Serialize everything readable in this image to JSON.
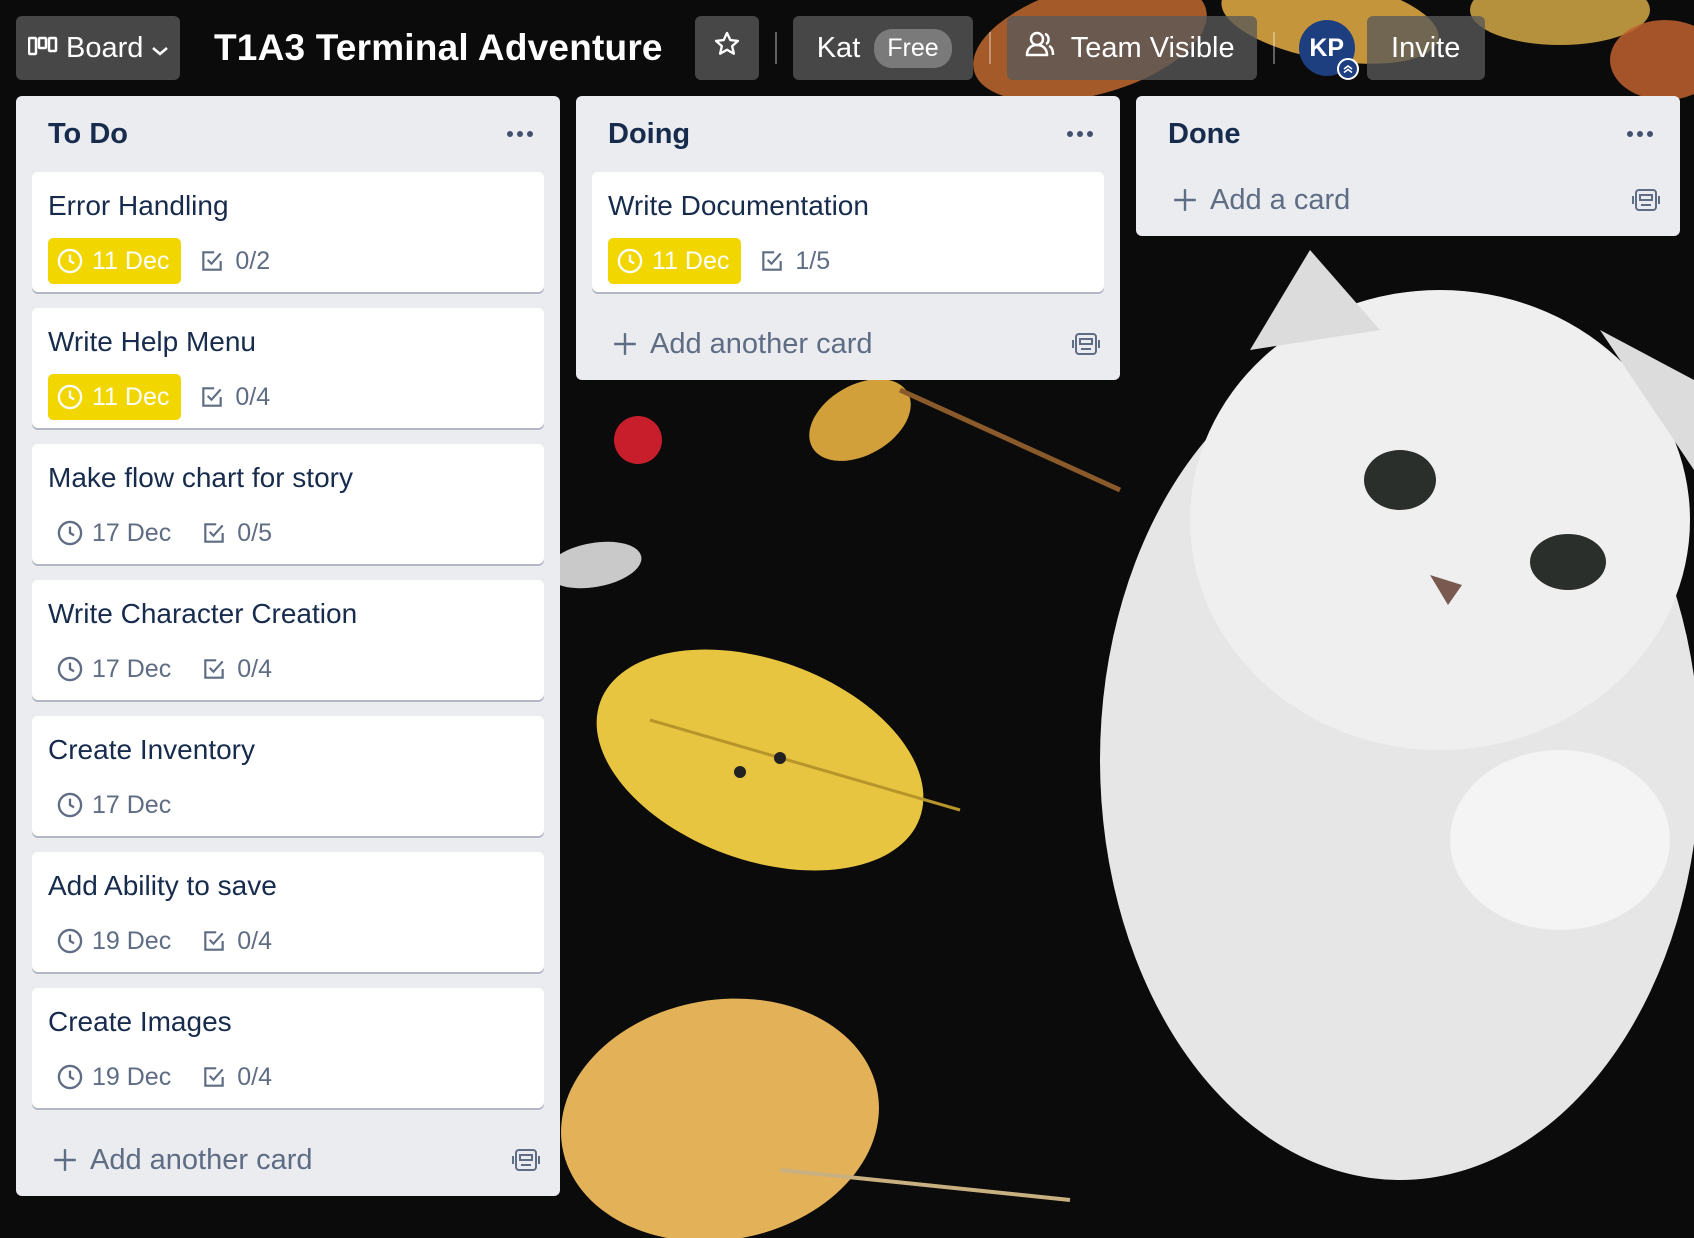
{
  "header": {
    "view_label": "Board",
    "board_title": "T1A3 Terminal Adventure",
    "workspace_name": "Kat",
    "plan_badge": "Free",
    "visibility_label": "Team Visible",
    "avatar_initials": "KP",
    "invite_label": "Invite"
  },
  "colors": {
    "due_soon": "#f2d600",
    "list_bg": "#ebecf0",
    "avatar_bg": "#1d3f80",
    "text_primary": "#172b4d",
    "text_muted": "#5e6c84"
  },
  "lists": [
    {
      "title": "To Do",
      "add_label": "Add another card",
      "cards": [
        {
          "title": "Error Handling",
          "due": "11 Dec",
          "due_soon": true,
          "checklist": "0/2"
        },
        {
          "title": "Write Help Menu",
          "due": "11 Dec",
          "due_soon": true,
          "checklist": "0/4"
        },
        {
          "title": "Make flow chart for story",
          "due": "17 Dec",
          "due_soon": false,
          "checklist": "0/5"
        },
        {
          "title": "Write Character Creation",
          "due": "17 Dec",
          "due_soon": false,
          "checklist": "0/4"
        },
        {
          "title": "Create Inventory",
          "due": "17 Dec",
          "due_soon": false,
          "checklist": ""
        },
        {
          "title": "Add Ability to save",
          "due": "19 Dec",
          "due_soon": false,
          "checklist": "0/4"
        },
        {
          "title": "Create Images",
          "due": "19 Dec",
          "due_soon": false,
          "checklist": "0/4"
        }
      ]
    },
    {
      "title": "Doing",
      "add_label": "Add another card",
      "cards": [
        {
          "title": "Write Documentation",
          "due": "11 Dec",
          "due_soon": true,
          "checklist": "1/5"
        }
      ]
    },
    {
      "title": "Done",
      "add_label": "Add a card",
      "cards": []
    }
  ]
}
